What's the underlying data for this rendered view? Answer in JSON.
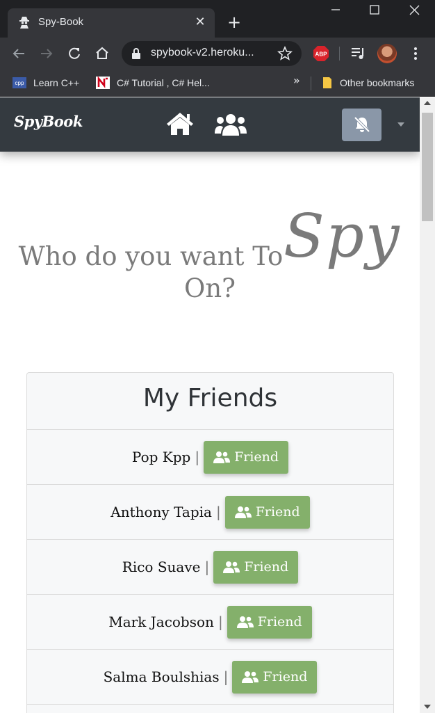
{
  "browser": {
    "tab_title": "Spy-Book",
    "url": "spybook-v2.heroku...",
    "bookmarks": [
      {
        "label": "Learn C++",
        "icon": "cpp-icon"
      },
      {
        "label": "C# Tutorial , C# Hel...",
        "icon": "n-icon"
      },
      {
        "label": "Other bookmarks",
        "icon": "folder-icon"
      }
    ],
    "bookmarks_overflow": "»",
    "extension_label": "ABP"
  },
  "navbar": {
    "brand": "SpyBook",
    "icons": [
      "home-icon",
      "users-icon",
      "bell-slash-icon",
      "caret-down-icon"
    ]
  },
  "hero": {
    "line": "Who do you want To",
    "spy": "Spy",
    "line2": "On?"
  },
  "friends_card": {
    "title": "My Friends",
    "separator": "|",
    "friend_button_label": "Friend",
    "friends": [
      {
        "name": "Pop Kpp"
      },
      {
        "name": "Anthony Tapia"
      },
      {
        "name": "Rico Suave"
      },
      {
        "name": "Mark Jacobson"
      },
      {
        "name": "Salma Boulshias"
      }
    ]
  },
  "colors": {
    "navbar_bg": "#343a40",
    "friend_button": "#84b06b",
    "notif_button": "#8a97a8",
    "hero_text": "#7a7a7a"
  }
}
